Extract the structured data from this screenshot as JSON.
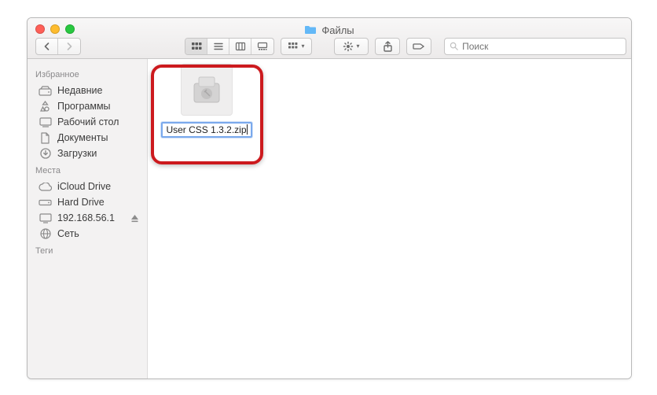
{
  "window": {
    "title": "Файлы"
  },
  "search": {
    "placeholder": "Поиск"
  },
  "sidebar": {
    "sections": [
      {
        "header": "Избранное",
        "items": [
          {
            "label": "Недавние",
            "icon": "clock-drive-icon"
          },
          {
            "label": "Программы",
            "icon": "apps-icon"
          },
          {
            "label": "Рабочий стол",
            "icon": "desktop-icon"
          },
          {
            "label": "Документы",
            "icon": "documents-icon"
          },
          {
            "label": "Загрузки",
            "icon": "downloads-icon"
          }
        ]
      },
      {
        "header": "Места",
        "items": [
          {
            "label": "iCloud Drive",
            "icon": "cloud-icon"
          },
          {
            "label": "Hard Drive",
            "icon": "disk-icon"
          },
          {
            "label": "192.168.56.1",
            "icon": "monitor-icon",
            "eject": true
          },
          {
            "label": "Сеть",
            "icon": "network-icon"
          }
        ]
      },
      {
        "header": "Теги",
        "items": []
      }
    ]
  },
  "file": {
    "name": "User CSS 1.3.2.zip"
  },
  "colors": {
    "highlight": "#cc1a1e",
    "selection": "#7aa9ec",
    "folder": "#63b8f7"
  }
}
